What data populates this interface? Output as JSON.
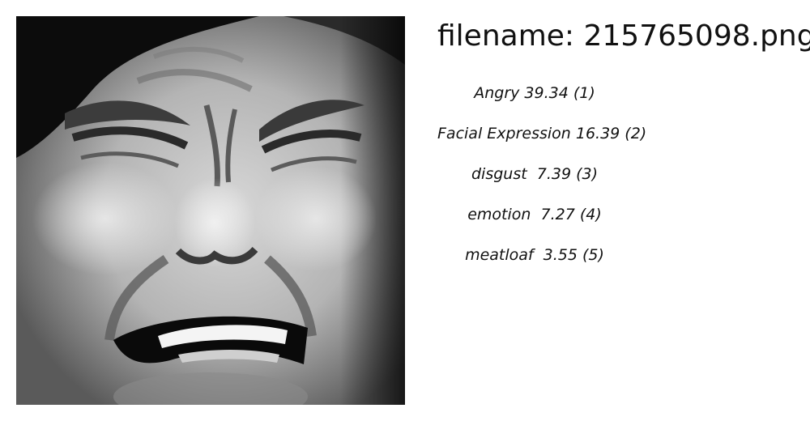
{
  "header": {
    "filename_text": "filename: 215765098.png"
  },
  "image": {
    "subject": "grayscale face with an angry, grimacing expression",
    "icon": "face-photo"
  },
  "predictions": [
    {
      "text": "Angry 39.34 (1)"
    },
    {
      "text": "Facial Expression 16.39 (2)"
    },
    {
      "text": "disgust  7.39 (3)"
    },
    {
      "text": "emotion  7.27 (4)"
    },
    {
      "text": "meatloaf  3.55 (5)"
    }
  ]
}
